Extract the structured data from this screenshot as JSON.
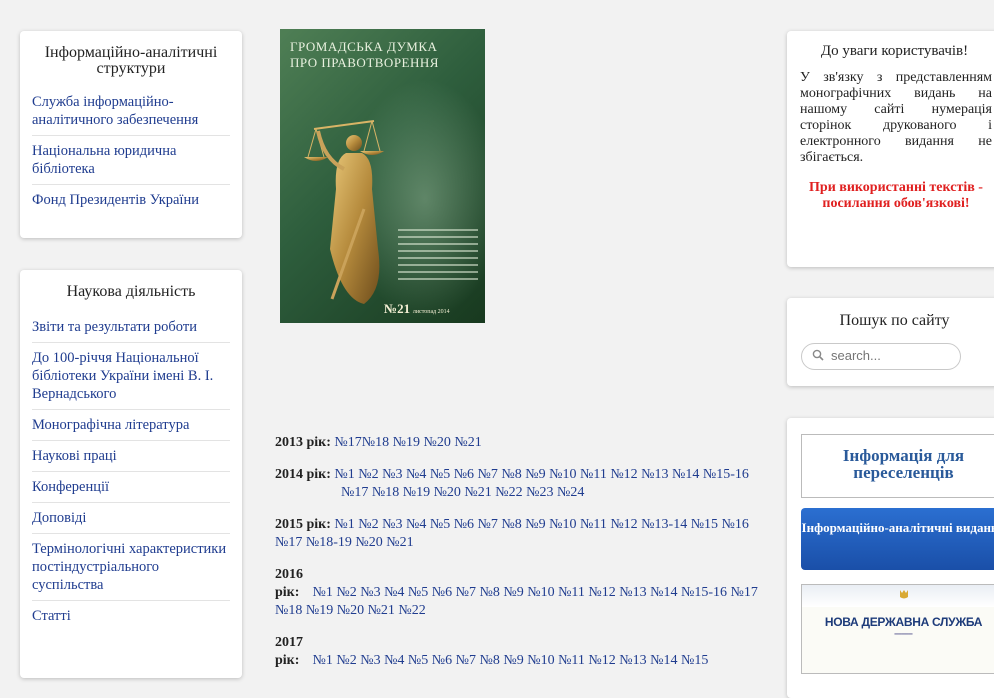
{
  "left": {
    "card1": {
      "title": "Інформаційно-аналітичні структури",
      "items": [
        "Служба інформаційно-аналітичного забезпечення",
        "Національна юридична бібліотека",
        "Фонд Президентів України"
      ]
    },
    "card2": {
      "title": "Наукова діяльність",
      "items": [
        "Звіти та результати роботи",
        "До 100-річчя Національної бібліотеки України імені В. І. Вернадського",
        "Монографічна література",
        "Наукові праці",
        "Конференції",
        "Доповіді",
        "Термінологічні характеристики постіндустріального суспільства",
        "Статті"
      ]
    }
  },
  "cover": {
    "title_line1": "Громадська думка",
    "title_line2": "про правотворення",
    "number": "№21",
    "date": "листопад 2014"
  },
  "years": [
    {
      "label": "2013 рік:",
      "issues": "№17№18 №19 №20 №21"
    },
    {
      "label": "2014 рік:",
      "issues": "№1 №2 №3 №4 №5 №6 №7 №8 №9 №10 №11 №12 №13 №14 №15-16 №17 №18 №19 №20 №21 №22 №23 №24"
    },
    {
      "label": "2015 рік:",
      "issues": "№1 №2 №3 №4 №5 №6 №7 №8 №9 №10 №11 №12 №13-14 №15 №16 №17 №18-19 №20 №21"
    },
    {
      "label": "2016 рік:",
      "issues": "№1 №2 №3 №4 №5 №6 №7 №8 №9 №10 №11 №12 №13 №14 №15-16 №17 №18 №19 №20 №21 №22"
    },
    {
      "label": "2017 рік:",
      "issues": "№1 №2 №3 №4 №5 №6 №7 №8 №9 №10 №11 №12 №13 №14 №15"
    }
  ],
  "right": {
    "notice": {
      "title": "До уваги користувачів!",
      "text": "У зв'язку з представленням монографічних видань на нашому сайті нумерація сторінок друкованого і електронного видання не збігається.",
      "warning": "При використанні текстів - посилання обов'язкові!"
    },
    "search": {
      "title": "Пошук по сайту",
      "placeholder": "search..."
    },
    "banners": {
      "banner1": "Інформація для переселенців",
      "banner2": "Інформаційно-аналітичні видання",
      "banner3_title": "НОВА ДЕРЖАВНА СЛУЖБА"
    }
  }
}
